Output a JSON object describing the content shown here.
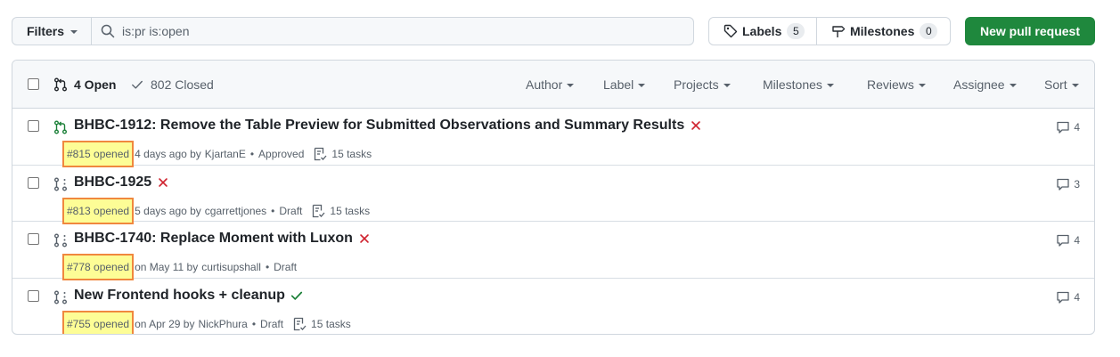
{
  "toolbar": {
    "filters_label": "Filters",
    "search_value": "is:pr is:open",
    "labels_label": "Labels",
    "labels_count": "5",
    "milestones_label": "Milestones",
    "milestones_count": "0",
    "new_pr_label": "New pull request"
  },
  "list_header": {
    "open_label": "4 Open",
    "closed_label": "802 Closed",
    "menus": [
      "Author",
      "Label",
      "Projects",
      "Milestones",
      "Reviews",
      "Assignee",
      "Sort"
    ]
  },
  "pull_requests": [
    {
      "title": "BHBC-1912: Remove the Table Preview for Submitted Observations and Summary Results",
      "status": "failing",
      "icon": "pr-open-icon",
      "number": "#815 opened",
      "opened": "4 days ago by",
      "author": "KjartanE",
      "review": "Approved",
      "tasks": "15 tasks",
      "comments": "4"
    },
    {
      "title": "BHBC-1925",
      "status": "failing",
      "icon": "pr-draft-icon",
      "number": "#813 opened",
      "opened": "5 days ago by",
      "author": "cgarrettjones",
      "review": "Draft",
      "tasks": "15 tasks",
      "comments": "3"
    },
    {
      "title": "BHBC-1740: Replace Moment with Luxon",
      "status": "failing",
      "icon": "pr-draft-icon",
      "number": "#778 opened",
      "opened": "on May 11 by",
      "author": "curtisupshall",
      "review": "Draft",
      "tasks": "",
      "comments": "4"
    },
    {
      "title": "New Frontend hooks + cleanup",
      "status": "passing",
      "icon": "pr-draft-icon",
      "number": "#755 opened",
      "opened": "on Apr 29 by",
      "author": "NickPhura",
      "review": "Draft",
      "tasks": "15 tasks",
      "comments": "4"
    }
  ],
  "colors": {
    "primary_button": "#1f883d",
    "open_icon": "#1a7f37",
    "fail": "#cf222e",
    "pass": "#1a7f37",
    "highlight": "#fdfd96",
    "highlight_border": "#f0883e"
  }
}
